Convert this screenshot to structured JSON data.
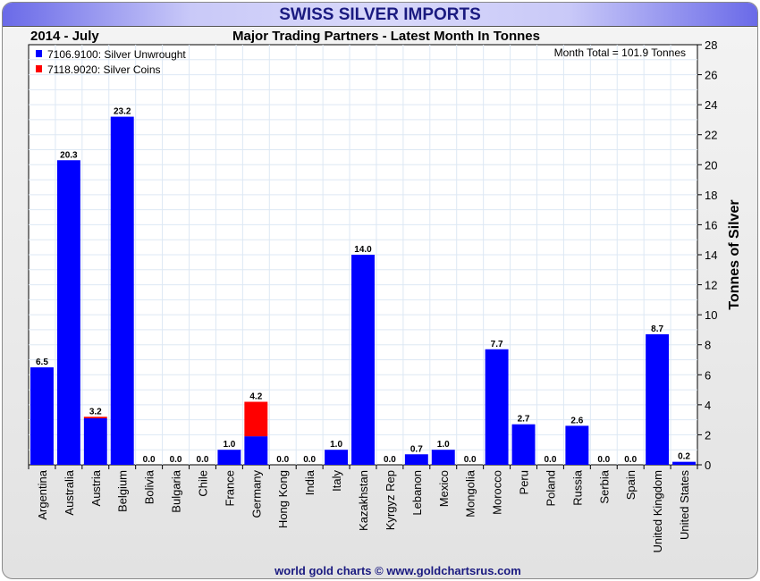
{
  "header": {
    "title": "SWISS SILVER IMPORTS",
    "period": "2014 - July",
    "subtitle": "Major Trading Partners - Latest Month In Tonnes"
  },
  "footer": {
    "credit": "world gold charts © www.goldchartsrus.com"
  },
  "chart_data": {
    "type": "bar",
    "stacked": true,
    "title": "SWISS SILVER IMPORTS",
    "subtitle": "Major Trading Partners - Latest Month In Tonnes",
    "annotation": "Month Total = 101.9 Tonnes",
    "ylabel": "Tonnes of Silver",
    "xlabel": "",
    "ylim": [
      0,
      28
    ],
    "yticks": [
      0,
      2,
      4,
      6,
      8,
      10,
      12,
      14,
      16,
      18,
      20,
      22,
      24,
      26,
      28
    ],
    "grid": true,
    "legend_position": "top-left",
    "categories": [
      "Argentina",
      "Australia",
      "Austria",
      "Belgium",
      "Bolivia",
      "Bulgaria",
      "Chile",
      "France",
      "Germany",
      "Hong Kong",
      "India",
      "Italy",
      "Kazakhstan",
      "Kyrgyz Rep",
      "Lebanon",
      "Mexico",
      "Mongolia",
      "Morocco",
      "Peru",
      "Poland",
      "Russia",
      "Serbia",
      "Spain",
      "United Kingdom",
      "United States"
    ],
    "series": [
      {
        "name": "7106.9100: Silver Unwrought",
        "color": "#0000ff",
        "values": [
          6.5,
          20.3,
          3.1,
          23.2,
          0,
          0,
          0,
          1.0,
          1.9,
          0,
          0,
          1.0,
          14.0,
          0,
          0.7,
          1.0,
          0,
          7.7,
          2.7,
          0,
          2.6,
          0,
          0,
          8.7,
          0.2
        ]
      },
      {
        "name": "7118.9020: Silver Coins",
        "color": "#ff0000",
        "values": [
          0,
          0,
          0.1,
          0,
          0,
          0,
          0,
          0,
          2.3,
          0,
          0,
          0,
          0,
          0,
          0,
          0,
          0,
          0,
          0,
          0,
          0,
          0,
          0,
          0,
          0
        ]
      }
    ],
    "totals_labels": [
      "6.5",
      "20.3",
      "3.2",
      "23.2",
      "0.0",
      "0.0",
      "0.0",
      "1.0",
      "4.2",
      "0.0",
      "0.0",
      "1.0",
      "14.0",
      "0.0",
      "0.7",
      "1.0",
      "0.0",
      "7.7",
      "2.7",
      "0.0",
      "2.6",
      "0.0",
      "0.0",
      "8.7",
      "0.2"
    ]
  }
}
